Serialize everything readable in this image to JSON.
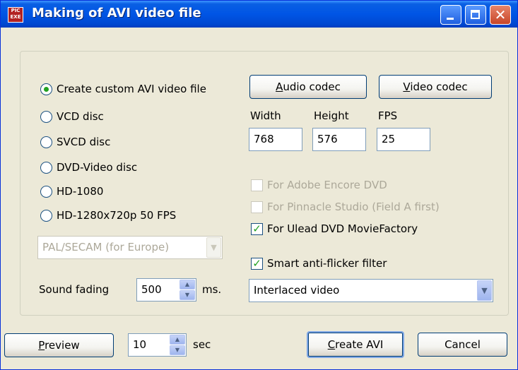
{
  "window": {
    "title": "Making of AVI video file",
    "icon_text": "PIC EXE"
  },
  "caption_buttons": {
    "close_glyph": "✕"
  },
  "format_options": [
    {
      "label": "Create custom AVI video file",
      "checked": true
    },
    {
      "label": "VCD disc",
      "checked": false
    },
    {
      "label": "SVCD disc",
      "checked": false
    },
    {
      "label": "DVD-Video disc",
      "checked": false
    },
    {
      "label": "HD-1080",
      "checked": false
    },
    {
      "label": "HD-1280x720p 50 FPS",
      "checked": false
    }
  ],
  "codecs": {
    "audio_pre": "",
    "audio_accel": "A",
    "audio_post": "udio codec",
    "video_pre": "",
    "video_accel": "V",
    "video_post": "ideo codec"
  },
  "dimensions": {
    "width_label": "Width",
    "height_label": "Height",
    "fps_label": "FPS",
    "width": "768",
    "height": "576",
    "fps": "25"
  },
  "tv_standard": {
    "value": "PAL/SECAM (for Europe)",
    "enabled": false
  },
  "compat_options": [
    {
      "label": "For Adobe Encore DVD",
      "checked": false,
      "enabled": false
    },
    {
      "label": "For Pinnacle Studio (Field A first)",
      "checked": false,
      "enabled": false
    },
    {
      "label": "For Ulead DVD MovieFactory",
      "checked": true,
      "enabled": true
    }
  ],
  "antiflicker": {
    "label": "Smart anti-flicker filter",
    "checked": true
  },
  "video_mode": {
    "value": "Interlaced video"
  },
  "sound_fading": {
    "label": "Sound fading",
    "value": "500",
    "unit": "ms."
  },
  "preview": {
    "pre": "",
    "accel": "P",
    "post": "review",
    "seconds": "10",
    "unit": "sec"
  },
  "actions": {
    "create_pre": "",
    "create_accel": "C",
    "create_post": "reate AVI",
    "cancel": "Cancel"
  },
  "glyphs": {
    "check": "✓",
    "dropdown": "▼",
    "spin_up": "▲",
    "spin_down": "▼"
  }
}
